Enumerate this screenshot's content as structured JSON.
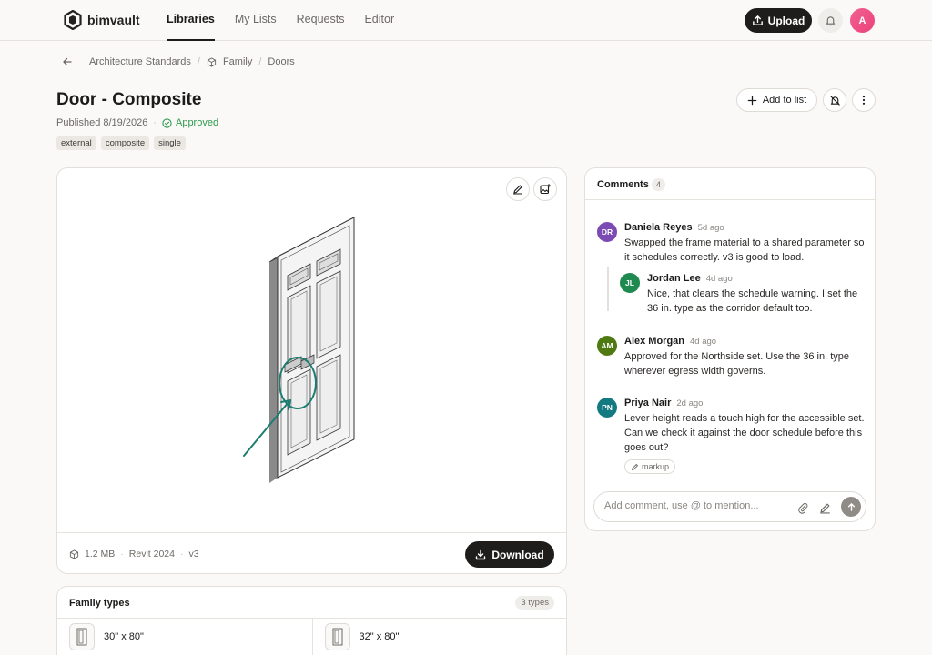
{
  "app": {
    "name": "bimvault"
  },
  "nav": {
    "tabs": [
      {
        "label": "Libraries"
      },
      {
        "label": "My Lists"
      },
      {
        "label": "Requests"
      },
      {
        "label": "Editor"
      }
    ],
    "upload_label": "Upload",
    "avatar_initial": "A"
  },
  "breadcrumb": {
    "items": [
      {
        "label": "Architecture Standards"
      },
      {
        "label": "Family"
      },
      {
        "label": "Doors"
      }
    ]
  },
  "asset": {
    "title": "Door - Composite",
    "published": "Published 8/19/2026",
    "status": "Approved",
    "tags": [
      "external",
      "composite",
      "single"
    ],
    "add_to_list_label": "Add to list"
  },
  "preview": {
    "file_size": "1.2 MB",
    "software": "Revit 2024",
    "version": "v3",
    "download_label": "Download"
  },
  "family_types": {
    "title": "Family types",
    "count_label": "3 types",
    "items": [
      {
        "label": "30\" x 80\""
      },
      {
        "label": "32\" x 80\""
      }
    ]
  },
  "comments": {
    "title": "Comments",
    "count": "4",
    "items": [
      {
        "initials": "DR",
        "name": "Daniela Reyes",
        "time": "5d ago",
        "text": "Swapped the frame material to a shared parameter so it schedules correctly. v3 is good to load.",
        "color": "#7b4bb3"
      },
      {
        "initials": "JL",
        "name": "Jordan Lee",
        "time": "4d ago",
        "text": "Nice, that clears the schedule warning. I set the 36 in. type as the corridor default too.",
        "color": "#1e8a4f"
      },
      {
        "initials": "AM",
        "name": "Alex Morgan",
        "time": "4d ago",
        "text": "Approved for the Northside set. Use the 36 in. type wherever egress width governs.",
        "color": "#4f7a12"
      },
      {
        "initials": "PN",
        "name": "Priya Nair",
        "time": "2d ago",
        "text": "Lever height reads a touch high for the accessible set. Can we check it against the door schedule before this goes out?",
        "color": "#137a82",
        "chip": "markup"
      }
    ],
    "input_placeholder": "Add comment, use @ to mention..."
  }
}
